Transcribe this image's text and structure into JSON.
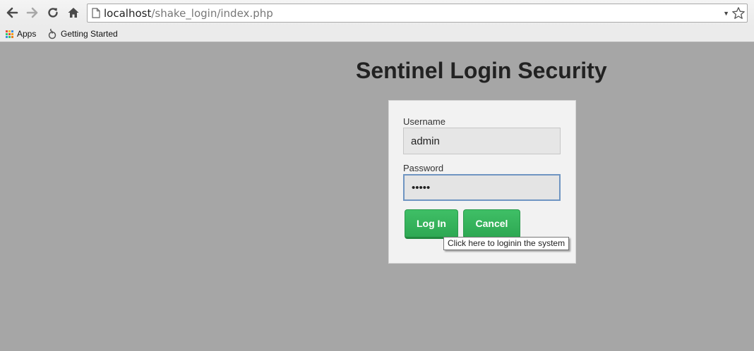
{
  "browser": {
    "url_host": "localhost",
    "url_path": "/shake_login/index.php",
    "bookmarks": [
      {
        "label": "Apps",
        "icon": "apps-grid-icon"
      },
      {
        "label": "Getting Started",
        "icon": "getting-started-icon"
      }
    ]
  },
  "page": {
    "title": "Sentinel Login Security"
  },
  "login": {
    "username_label": "Username",
    "username_value": "admin",
    "password_label": "Password",
    "password_value": "•••••",
    "login_button": "Log In",
    "cancel_button": "Cancel",
    "tooltip": "Click here to loginin the system"
  },
  "colors": {
    "page_background": "#a6a6a6",
    "button_green": "#34b35a",
    "focus_border": "#6f95c2"
  }
}
